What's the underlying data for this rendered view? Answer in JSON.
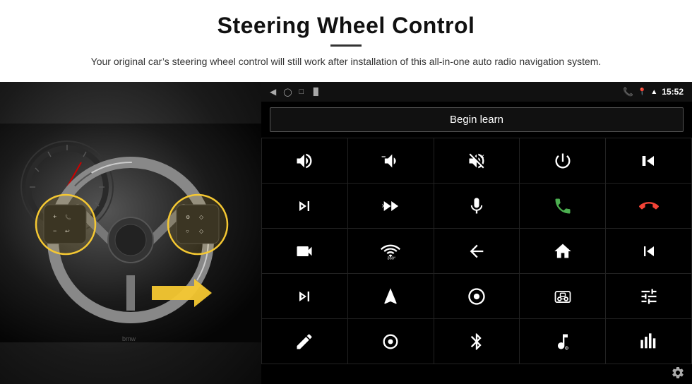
{
  "header": {
    "title": "Steering Wheel Control",
    "subtitle": "Your original car’s steering wheel control will still work after installation of this all-in-one auto radio navigation system."
  },
  "status_bar": {
    "time": "15:52",
    "nav_icons": [
      "back-arrow",
      "home-oval",
      "recents-square",
      "signal-bars",
      "phone-icon",
      "location-icon",
      "wifi-icon"
    ]
  },
  "begin_learn": {
    "label": "Begin learn"
  },
  "icons": [
    {
      "name": "volume-up",
      "row": 1,
      "col": 1
    },
    {
      "name": "volume-down",
      "row": 1,
      "col": 2
    },
    {
      "name": "volume-mute",
      "row": 1,
      "col": 3
    },
    {
      "name": "power",
      "row": 1,
      "col": 4
    },
    {
      "name": "prev-track",
      "row": 1,
      "col": 5
    },
    {
      "name": "next-track",
      "row": 2,
      "col": 1
    },
    {
      "name": "fast-forward",
      "row": 2,
      "col": 2
    },
    {
      "name": "microphone",
      "row": 2,
      "col": 3
    },
    {
      "name": "phone",
      "row": 2,
      "col": 4
    },
    {
      "name": "hang-up",
      "row": 2,
      "col": 5
    },
    {
      "name": "camera",
      "row": 3,
      "col": 1
    },
    {
      "name": "360-view",
      "row": 3,
      "col": 2
    },
    {
      "name": "back",
      "row": 3,
      "col": 3
    },
    {
      "name": "home",
      "row": 3,
      "col": 4
    },
    {
      "name": "skip-back",
      "row": 3,
      "col": 5
    },
    {
      "name": "skip-forward",
      "row": 4,
      "col": 1
    },
    {
      "name": "navigate",
      "row": 4,
      "col": 2
    },
    {
      "name": "equalizer",
      "row": 4,
      "col": 3
    },
    {
      "name": "music",
      "row": 4,
      "col": 4
    },
    {
      "name": "sliders",
      "row": 4,
      "col": 5
    },
    {
      "name": "pen",
      "row": 5,
      "col": 1
    },
    {
      "name": "record",
      "row": 5,
      "col": 2
    },
    {
      "name": "bluetooth",
      "row": 5,
      "col": 3
    },
    {
      "name": "music-settings",
      "row": 5,
      "col": 4
    },
    {
      "name": "equalizer-bars",
      "row": 5,
      "col": 5
    }
  ],
  "settings": {
    "label": "Settings"
  }
}
